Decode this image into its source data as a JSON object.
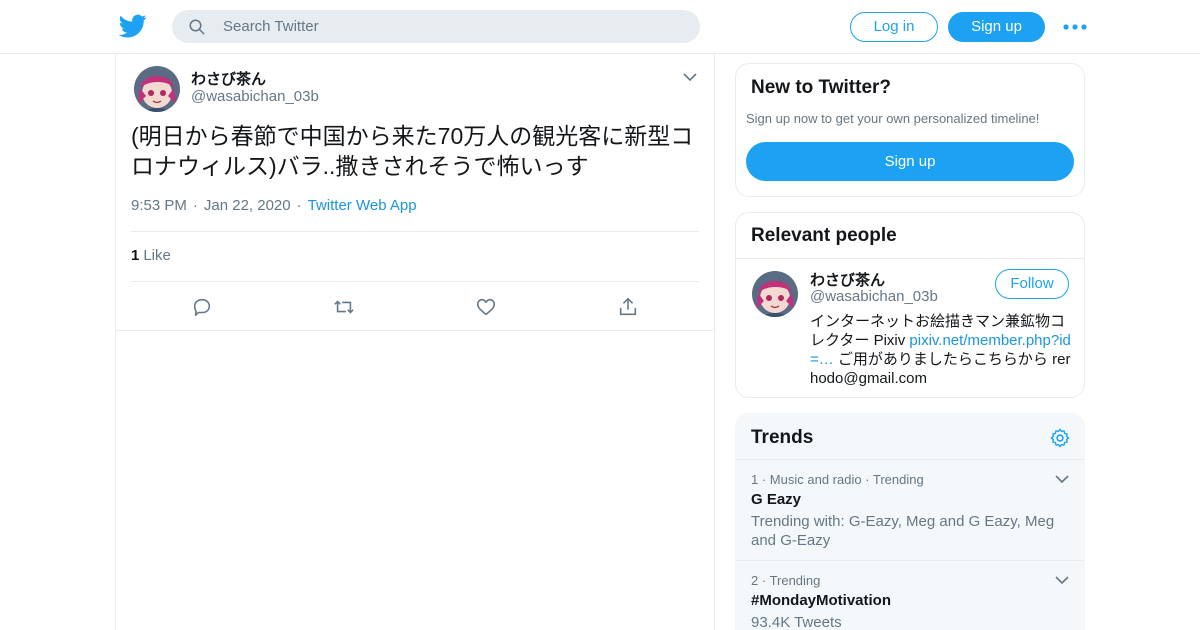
{
  "brand": {
    "accent": "#1da1f2",
    "link": "#1b95e0",
    "muted": "#657786",
    "logo": "twitter-bird-icon"
  },
  "header": {
    "search_placeholder": "Search Twitter",
    "login_label": "Log in",
    "signup_label": "Sign up",
    "more_icon": "more-dots-icon"
  },
  "tweet": {
    "author_name": "わさび茶ん",
    "author_handle": "@wasabichan_03b",
    "text": "(明日から春節で中国から来た70万人の観光客に新型コロナウィルス)バラ..撒きされそうで怖いっす",
    "time": "9:53 PM",
    "date": "Jan 22, 2020",
    "source": "Twitter Web App",
    "like_count": "1",
    "like_label": "Like",
    "actions": [
      "reply-icon",
      "retweet-icon",
      "like-icon",
      "share-icon"
    ]
  },
  "sidebar": {
    "new_to_twitter": {
      "title": "New to Twitter?",
      "subtitle": "Sign up now to get your own personalized timeline!",
      "signup_label": "Sign up"
    },
    "relevant_people": {
      "title": "Relevant people",
      "name": "わさび茶ん",
      "handle": "@wasabichan_03b",
      "follow_label": "Follow",
      "bio_before": "インターネットお絵描きマン兼鉱物コレクター Pixiv ",
      "bio_link": "pixiv.net/member.php?id=…",
      "bio_after": " ご用がありましたらこちらから rerhodo@gmail.com"
    },
    "trends": {
      "title": "Trends",
      "items": [
        {
          "rank": "1",
          "context": "Music and radio · Trending",
          "name": "G Eazy",
          "extra": "Trending with: G-Eazy, Meg and G Eazy, Meg and G-Eazy"
        },
        {
          "rank": "2",
          "context": "Trending",
          "name": "#MondayMotivation",
          "extra": "93.4K Tweets"
        }
      ]
    }
  }
}
